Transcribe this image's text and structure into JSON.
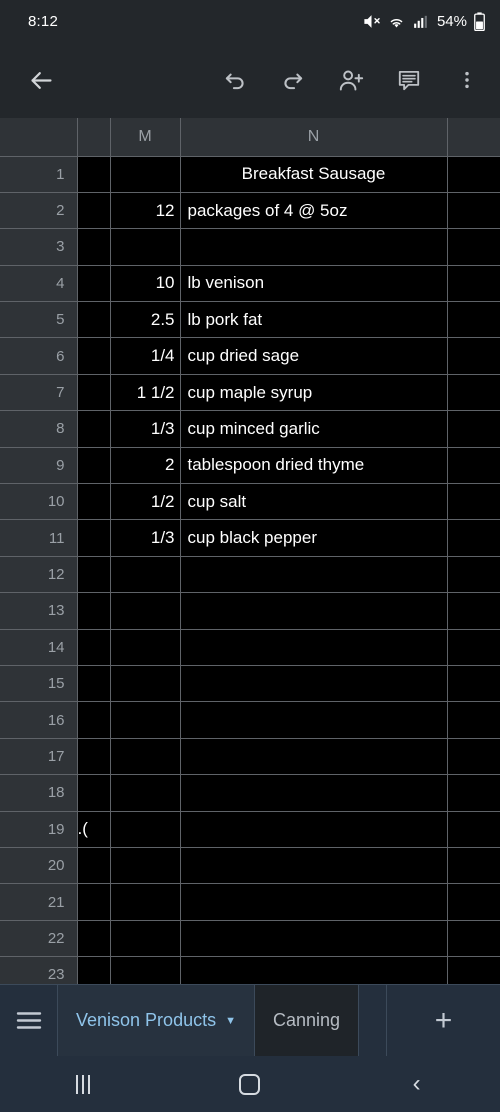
{
  "status_bar": {
    "time": "8:12",
    "battery_percent": "54%",
    "icons": [
      "volume-mute-icon",
      "wifi-icon",
      "cellular-signal-icon",
      "battery-icon"
    ]
  },
  "toolbar": {
    "back_label": "Back",
    "undo_label": "Undo",
    "redo_label": "Redo",
    "share_label": "Share",
    "comment_label": "Comment",
    "more_label": "More options"
  },
  "spreadsheet": {
    "column_headers": [
      "",
      "",
      "M",
      "N",
      ""
    ],
    "rows": [
      {
        "num": "1",
        "L": "",
        "M": "",
        "N": "Breakfast Sausage",
        "N_align": "center"
      },
      {
        "num": "2",
        "L": "",
        "M": "12",
        "N": "packages of 4 @ 5oz"
      },
      {
        "num": "3",
        "L": "",
        "M": "",
        "N": ""
      },
      {
        "num": "4",
        "L": "",
        "M": "10",
        "N": "lb venison"
      },
      {
        "num": "5",
        "L": "",
        "M": "2.5",
        "N": "lb pork fat"
      },
      {
        "num": "6",
        "L": "",
        "M": "1/4",
        "N": "cup dried sage"
      },
      {
        "num": "7",
        "L": "",
        "M": "1 1/2",
        "N": "cup maple syrup",
        "M_overflow": true
      },
      {
        "num": "8",
        "L": "",
        "M": "1/3",
        "N": "cup minced garlic"
      },
      {
        "num": "9",
        "L": "",
        "M": "2",
        "N": "tablespoon dried thyme"
      },
      {
        "num": "10",
        "L": "",
        "M": "1/2",
        "N": "cup salt"
      },
      {
        "num": "11",
        "L": "",
        "M": "1/3",
        "N": "cup black pepper"
      },
      {
        "num": "12",
        "L": "",
        "M": "",
        "N": ""
      },
      {
        "num": "13",
        "L": "",
        "M": "",
        "N": ""
      },
      {
        "num": "14",
        "L": "",
        "M": "",
        "N": ""
      },
      {
        "num": "15",
        "L": "",
        "M": "",
        "N": ""
      },
      {
        "num": "16",
        "L": "",
        "M": "",
        "N": ""
      },
      {
        "num": "17",
        "L": "",
        "M": "",
        "N": ""
      },
      {
        "num": "18",
        "L": "",
        "M": "",
        "N": ""
      },
      {
        "num": "19",
        "L": ").",
        "M": "",
        "N": "",
        "L_clipped": true
      },
      {
        "num": "20",
        "L": "",
        "M": "",
        "N": ""
      },
      {
        "num": "21",
        "L": "",
        "M": "",
        "N": ""
      },
      {
        "num": "22",
        "L": "",
        "M": "",
        "N": ""
      },
      {
        "num": "23",
        "L": "",
        "M": "",
        "N": ""
      }
    ]
  },
  "tab_bar": {
    "menu_label": "All sheets",
    "tabs": [
      {
        "label": "Venison Products",
        "active": true,
        "caret": "▼"
      },
      {
        "label": "Canning",
        "active": false
      }
    ],
    "add_label": "+"
  },
  "nav_bar": {
    "recents_label": "Recents",
    "home_label": "Home",
    "back_label": "Back"
  },
  "colors": {
    "chrome": "#23272b",
    "grid_line": "#5f6368",
    "cell_bg": "#000000",
    "header_bg": "#2f3337",
    "header_text": "#9aa0a6",
    "tabbar_bg": "#242f3d",
    "active_tab_text": "#8fc4ea"
  }
}
